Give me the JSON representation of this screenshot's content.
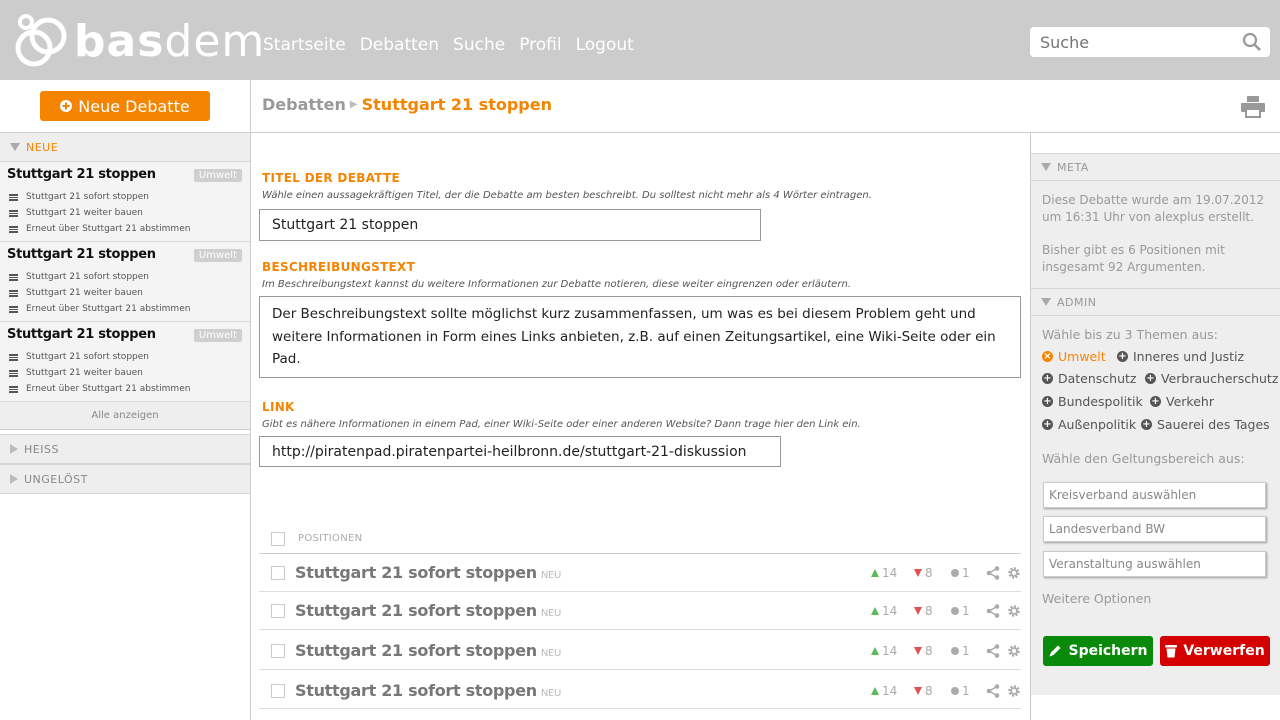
{
  "app": {
    "logo_text_bold": "bas",
    "logo_text_light": "dem"
  },
  "nav": {
    "items": [
      "Startseite",
      "Debatten",
      "Suche",
      "Profil",
      "Logout"
    ]
  },
  "search": {
    "placeholder": "Suche"
  },
  "sidebar": {
    "new_button": "Neue Debatte",
    "sections": {
      "neue": "NEUE",
      "heiss": "HEISS",
      "ungeloest": "UNGELÖST"
    },
    "debates": [
      {
        "title": "Stuttgart 21 stoppen",
        "badge": "Umwelt",
        "positions": [
          "Stuttgart 21 sofort stoppen",
          "Stuttgart 21 weiter bauen",
          "Erneut über Stuttgart 21 abstimmen"
        ]
      },
      {
        "title": "Stuttgart 21 stoppen",
        "badge": "Umwelt",
        "positions": [
          "Stuttgart 21 sofort stoppen",
          "Stuttgart 21 weiter bauen",
          "Erneut über Stuttgart 21 abstimmen"
        ]
      },
      {
        "title": "Stuttgart 21 stoppen",
        "badge": "Umwelt",
        "positions": [
          "Stuttgart 21 sofort stoppen",
          "Stuttgart 21 weiter bauen",
          "Erneut über Stuttgart 21 abstimmen"
        ]
      }
    ],
    "show_all": "Alle anzeigen"
  },
  "breadcrumb": {
    "parent": "Debatten",
    "current": "Stuttgart 21 stoppen"
  },
  "form": {
    "title_label": "TITEL DER DEBATTE",
    "title_help": "Wähle einen aussagekräftigen Titel, der die Debatte am besten beschreibt. Du solltest nicht mehr als 4 Wörter eintragen.",
    "title_value": "Stuttgart 21 stoppen",
    "desc_label": "BESCHREIBUNGSTEXT",
    "desc_help": "Im Beschreibungstext kannst du weitere Informationen zur Debatte notieren, diese weiter eingrenzen oder erläutern.",
    "desc_value": "Der Beschreibungstext sollte möglichst kurz zusammenfassen, um was es bei diesem Problem geht und weitere Informationen in Form eines Links anbieten, z.B. auf einen Zeitungsartikel, eine Wiki-Seite oder ein Pad.",
    "link_label": "LINK",
    "link_help": "Gibt es nähere Informationen in einem Pad, einer Wiki-Seite oder einer anderen Website? Dann trage hier den Link ein.",
    "link_value": "http://piratenpad.piratenpartei-heilbronn.de/stuttgart-21-diskussion"
  },
  "positions": {
    "header": "POSITIONEN",
    "rows": [
      {
        "title": "Stuttgart 21 sofort stoppen",
        "tag": "NEU",
        "up": "14",
        "down": "8",
        "comments": "1"
      },
      {
        "title": "Stuttgart 21 sofort stoppen",
        "tag": "NEU",
        "up": "14",
        "down": "8",
        "comments": "1"
      },
      {
        "title": "Stuttgart 21 sofort stoppen",
        "tag": "NEU",
        "up": "14",
        "down": "8",
        "comments": "1"
      },
      {
        "title": "Stuttgart 21 sofort stoppen",
        "tag": "NEU",
        "up": "14",
        "down": "8",
        "comments": "1"
      }
    ]
  },
  "meta": {
    "head": "META",
    "created": "Diese Debatte wurde am 19.07.2012 um 16:31 Uhr von alexplus erstellt.",
    "stats": "Bisher gibt es 6 Positionen mit insgesamt 92 Argumenten."
  },
  "admin": {
    "head": "ADMIN",
    "topics_label": "Wähle bis zu 3 Themen aus:",
    "topics": [
      "Umwelt",
      "Inneres und Justiz",
      "Datenschutz",
      "Verbraucherschutz",
      "Bundespolitik",
      "Verkehr",
      "Außenpolitik",
      "Sauerei des Tages"
    ],
    "scope_label": "Wähle den Geltungsbereich aus:",
    "scope_selects": [
      "Kreisverband auswählen",
      "Landesverband BW",
      "Veranstaltung auswählen"
    ],
    "more_options": "Weitere Optionen",
    "save": "Speichern",
    "discard": "Verwerfen"
  },
  "colors": {
    "accent": "#f58400",
    "topbar": "#cccccc",
    "save": "#0a8a0a",
    "discard": "#d40000"
  }
}
